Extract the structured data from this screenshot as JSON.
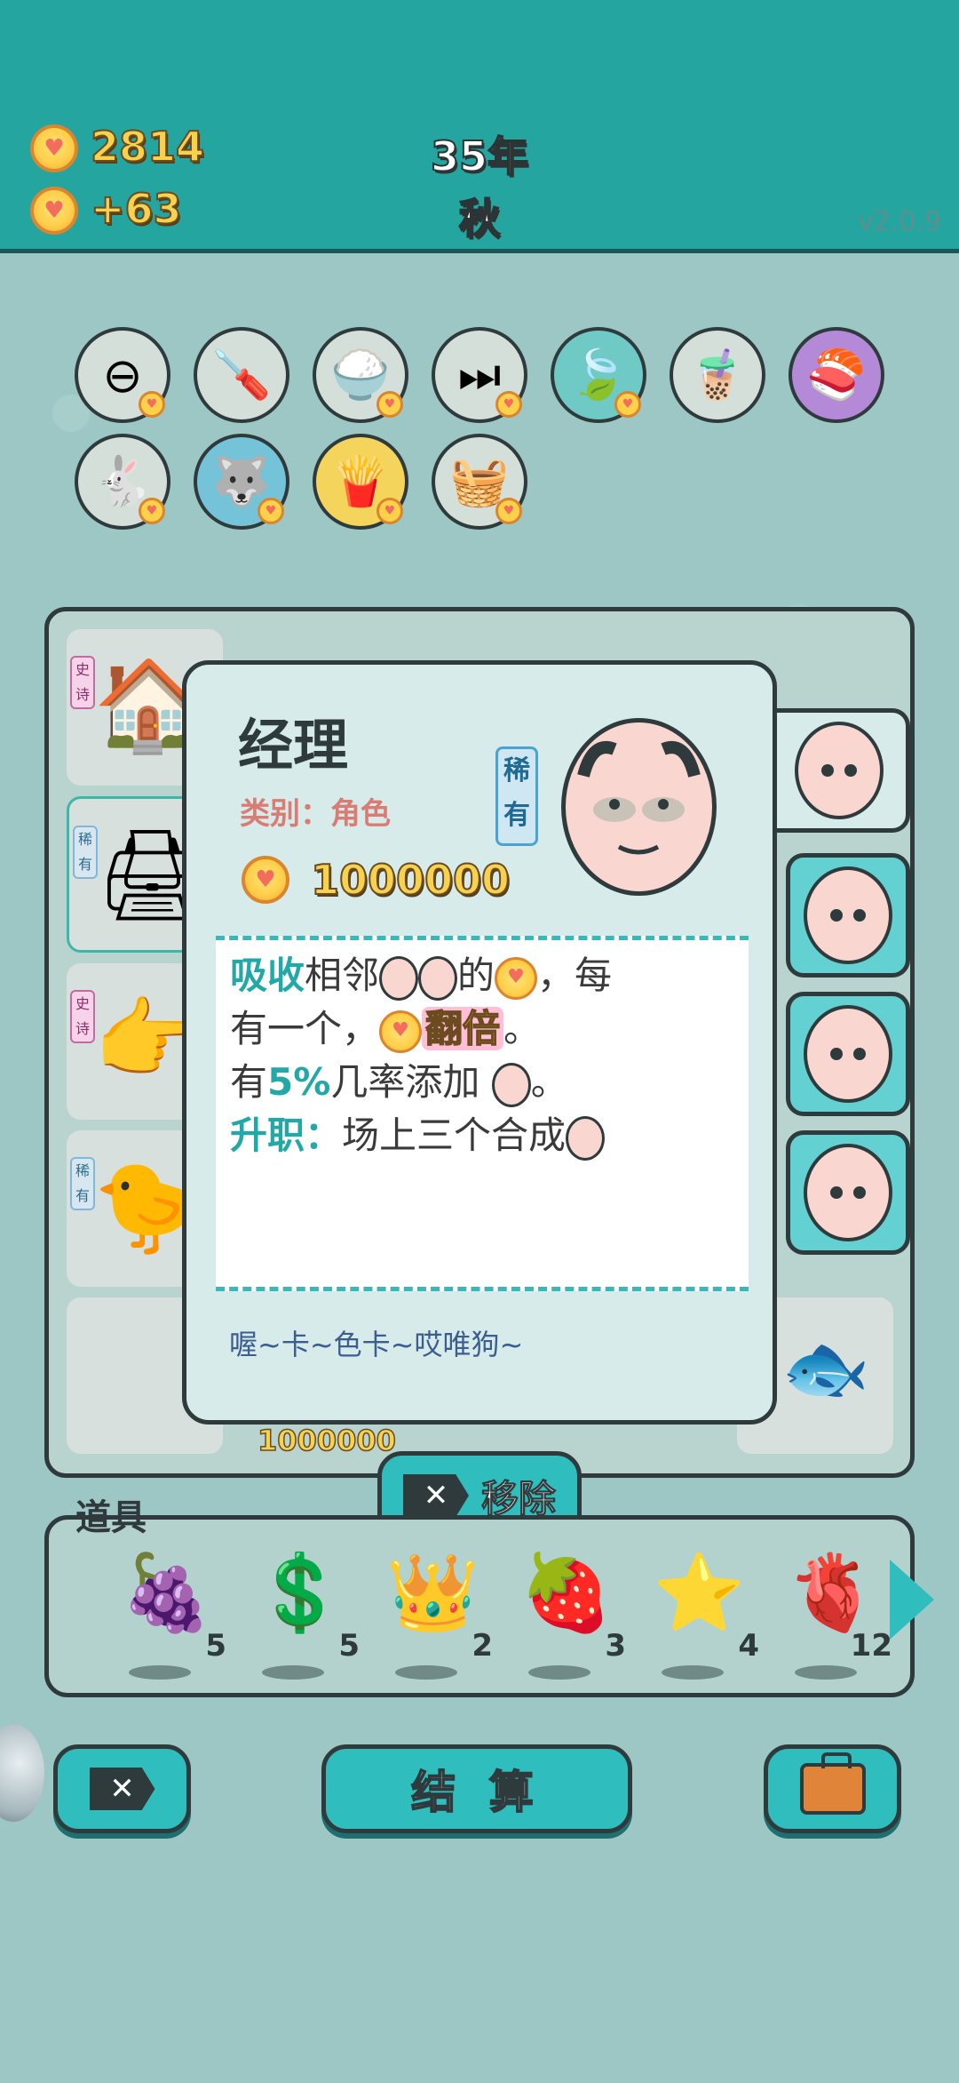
{
  "header": {
    "coins": "2814",
    "income": "+63",
    "year": "35年",
    "season": "秋",
    "version": "v2.0.9"
  },
  "relics": [
    {
      "name": "no-entry-icon",
      "glyph": "⊖"
    },
    {
      "name": "screwdriver-icon",
      "glyph": "🪛"
    },
    {
      "name": "rice-bowl-icon",
      "glyph": "🍚"
    },
    {
      "name": "skip-icon",
      "glyph": "⏭"
    },
    {
      "name": "leaf-icon",
      "glyph": "🍃"
    },
    {
      "name": "bubble-tea-icon",
      "glyph": "🧋"
    },
    {
      "name": "sushi-icon",
      "glyph": "🍣"
    },
    {
      "name": "rabbit-icon",
      "glyph": "🐇"
    },
    {
      "name": "husky-icon",
      "glyph": "🐺"
    },
    {
      "name": "fries-icon",
      "glyph": "🍟"
    },
    {
      "name": "fruit-basket-icon",
      "glyph": "🧺"
    }
  ],
  "board": {
    "price_label": "1000000",
    "cells": [
      {
        "tag": "史诗",
        "glyph": "🏠"
      },
      {
        "tag": "稀有",
        "glyph": "🖨"
      },
      {
        "tag": "史诗",
        "glyph": "👉"
      },
      {
        "tag": "稀有",
        "glyph": "🐤"
      }
    ]
  },
  "popup": {
    "title": "经理",
    "category": "类别：角色",
    "rarity": "稀有",
    "price": "1000000",
    "desc": {
      "l1_absorb": "吸收",
      "l1_neighbor": "相邻",
      "l1_of": "的",
      "l1_each": "，每",
      "l2_has": "有一个，",
      "l2_double": "翻倍",
      "l2_end": "。",
      "l3_has": "有",
      "l3_pct": "5%",
      "l3_chance": "几率添加",
      "l3_end": "。",
      "l4_promote": "升职：",
      "l4_text": "场上三个合成"
    },
    "quote": "喔~卡~色卡~哎唯狗~"
  },
  "remove_button": "移除",
  "items": {
    "label": "道具",
    "list": [
      {
        "glyph": "🍇",
        "count": "5",
        "name": "bayberry-icon"
      },
      {
        "glyph": "💲",
        "count": "5",
        "name": "dollar-coin-icon"
      },
      {
        "glyph": "👑",
        "count": "2",
        "name": "crown-icon"
      },
      {
        "glyph": "🍓",
        "count": "3",
        "name": "strawberry-icon"
      },
      {
        "glyph": "⭐",
        "count": "4",
        "name": "star-icon"
      },
      {
        "glyph": "🫀",
        "count": "12",
        "name": "liver-icon"
      }
    ]
  },
  "bottom": {
    "settle": "结 算"
  }
}
